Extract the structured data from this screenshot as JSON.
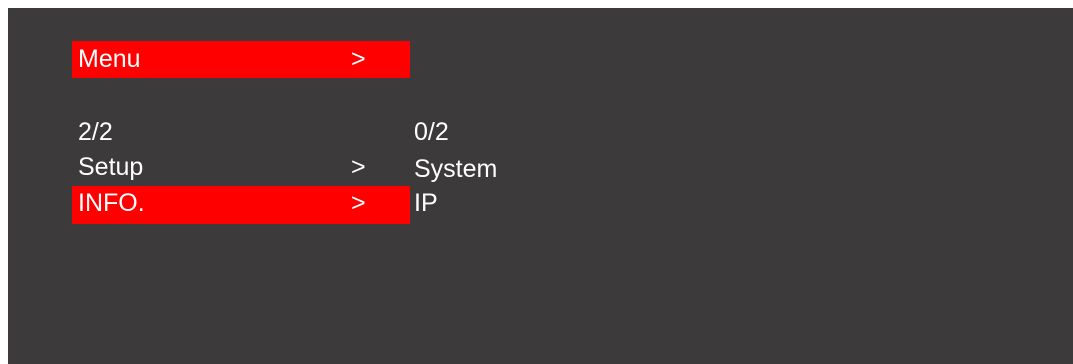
{
  "colors": {
    "background": "#3c3a3a",
    "highlight": "#fe0000",
    "text": "#ffffff"
  },
  "header": {
    "title": "Menu",
    "arrow": ">"
  },
  "left_panel": {
    "page_indicator": "2/2",
    "items": [
      {
        "label": "Setup",
        "arrow": ">",
        "selected": false
      },
      {
        "label": "INFO.",
        "arrow": ">",
        "selected": true
      }
    ]
  },
  "right_panel": {
    "page_indicator": "0/2",
    "items": [
      {
        "label": "System"
      },
      {
        "label": "IP"
      }
    ]
  }
}
